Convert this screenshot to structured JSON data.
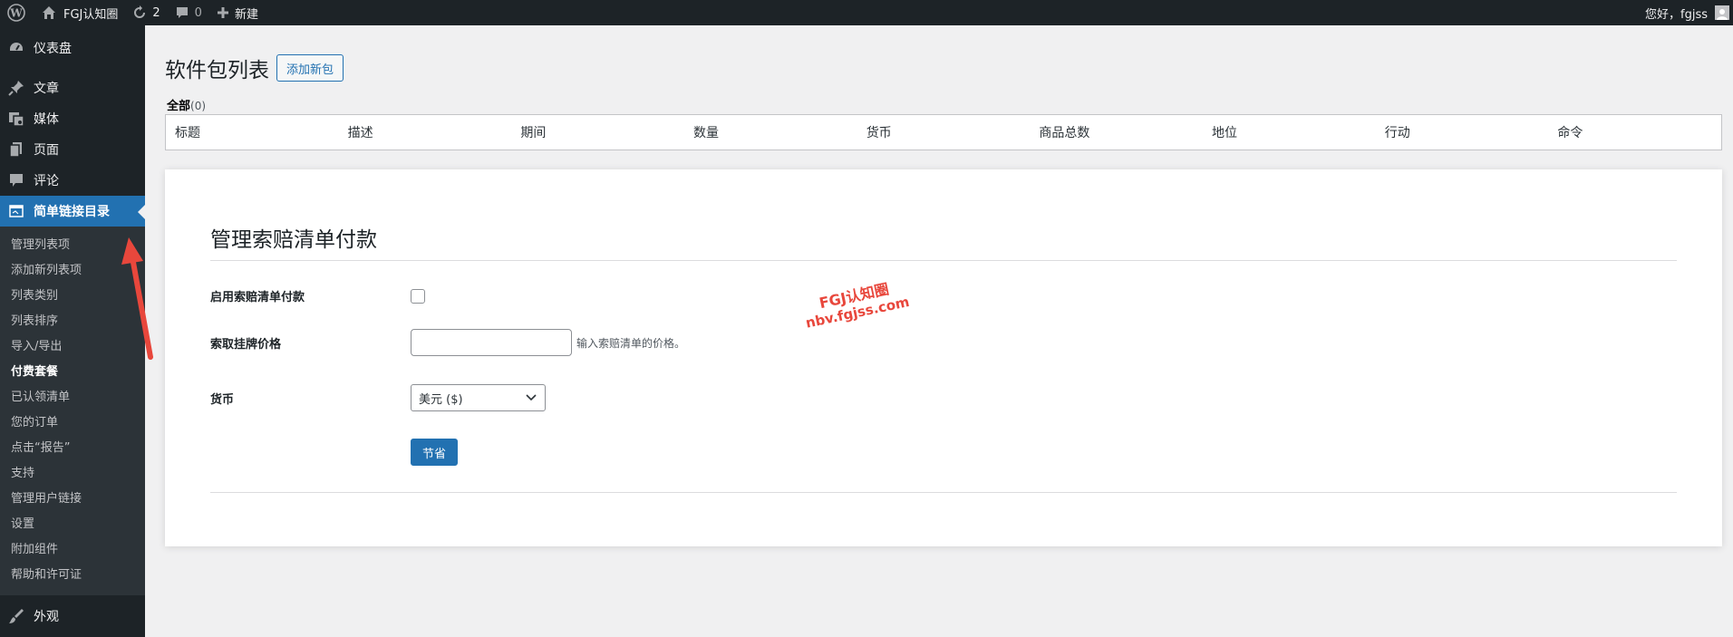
{
  "adminbar": {
    "site_name": "FGJ认知圈",
    "updates_count": "2",
    "comments_count": "0",
    "new_label": "新建",
    "greeting": "您好，fgjss"
  },
  "sidebar": {
    "top_items": [
      {
        "label": "仪表盘",
        "icon": "dashboard-icon"
      },
      {
        "label": "文章",
        "icon": "pin-icon"
      },
      {
        "label": "媒体",
        "icon": "media-icon"
      },
      {
        "label": "页面",
        "icon": "page-icon"
      },
      {
        "label": "评论",
        "icon": "comment-icon"
      }
    ],
    "current_item": {
      "label": "简单链接目录",
      "icon": "directory-icon"
    },
    "submenu": [
      "管理列表项",
      "添加新列表项",
      "列表类别",
      "列表排序",
      "导入/导出",
      "付费套餐",
      "已认领清单",
      "您的订单",
      "点击“报告”",
      "支持",
      "管理用户链接",
      "设置",
      "附加组件",
      "帮助和许可证"
    ],
    "bottom_item": {
      "label": "外观",
      "icon": "paintbrush-icon"
    }
  },
  "main": {
    "page_title": "软件包列表",
    "add_new_label": "添加新包",
    "filter": {
      "label": "全部",
      "count": "(0)"
    },
    "table_headers": [
      "标题",
      "描述",
      "期间",
      "数量",
      "货币",
      "商品总数",
      "地位",
      "行动",
      "命令"
    ],
    "settings": {
      "title": "管理索赔清单付款",
      "enable_label": "启用索赔清单付款",
      "price_label": "索取挂牌价格",
      "price_value": "",
      "price_desc": "输入索赔清单的价格。",
      "currency_label": "货币",
      "currency_value": "美元 ($)",
      "save_label": "节省"
    }
  },
  "watermark": {
    "line1": "FGJ认知圈",
    "line2": "nbv.fgjss.com"
  },
  "colors": {
    "admin_bg": "#1d2327",
    "submenu_bg": "#2c3338",
    "accent": "#2271b1",
    "page_bg": "#f0f0f1",
    "arrow": "#e8473c"
  }
}
